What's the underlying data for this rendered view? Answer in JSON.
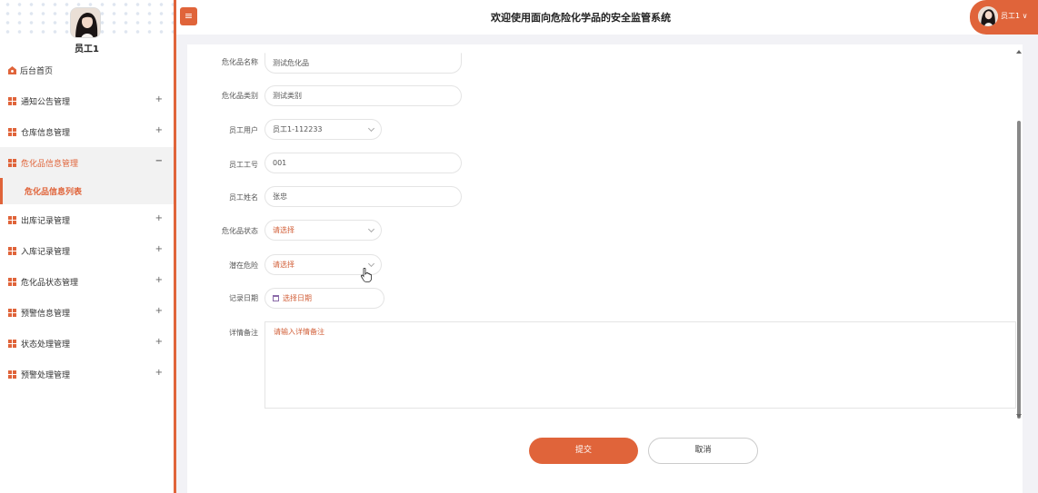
{
  "sidebar": {
    "user_name": "员工1",
    "home_label": "后台首页",
    "items": [
      {
        "label": "通知公告管理",
        "toggle": "+"
      },
      {
        "label": "仓库信息管理",
        "toggle": "+"
      },
      {
        "label": "危化品信息管理",
        "toggle": "−"
      },
      {
        "label": "出库记录管理",
        "toggle": "+"
      },
      {
        "label": "入库记录管理",
        "toggle": "+"
      },
      {
        "label": "危化品状态管理",
        "toggle": "+"
      },
      {
        "label": "预警信息管理",
        "toggle": "+"
      },
      {
        "label": "状态处理管理",
        "toggle": "+"
      },
      {
        "label": "预警处理管理",
        "toggle": "+"
      }
    ],
    "sub_item": "危化品信息列表"
  },
  "header": {
    "menu_icon": "≡",
    "title": "欢迎使用面向危险化学品的安全监管系统",
    "user_label": "员工1 ∨"
  },
  "form": {
    "chem_name": {
      "label": "危化品名称",
      "value": "测试危化品"
    },
    "chem_category": {
      "label": "危化品类别",
      "value": "测试类别"
    },
    "employee_user": {
      "label": "员工用户",
      "value": "员工1-112233"
    },
    "employee_no": {
      "label": "员工工号",
      "value": "001"
    },
    "employee_name": {
      "label": "员工姓名",
      "value": "张忠"
    },
    "chem_status": {
      "label": "危化品状态",
      "placeholder": "请选择"
    },
    "potential_risk": {
      "label": "潜在危险",
      "placeholder": "请选择"
    },
    "record_date": {
      "label": "记录日期",
      "placeholder": "选择日期"
    },
    "remarks": {
      "label": "详情备注",
      "placeholder": "请输入详情备注"
    }
  },
  "buttons": {
    "submit": "提交",
    "cancel": "取消"
  },
  "colors": {
    "accent": "#e0643a"
  }
}
